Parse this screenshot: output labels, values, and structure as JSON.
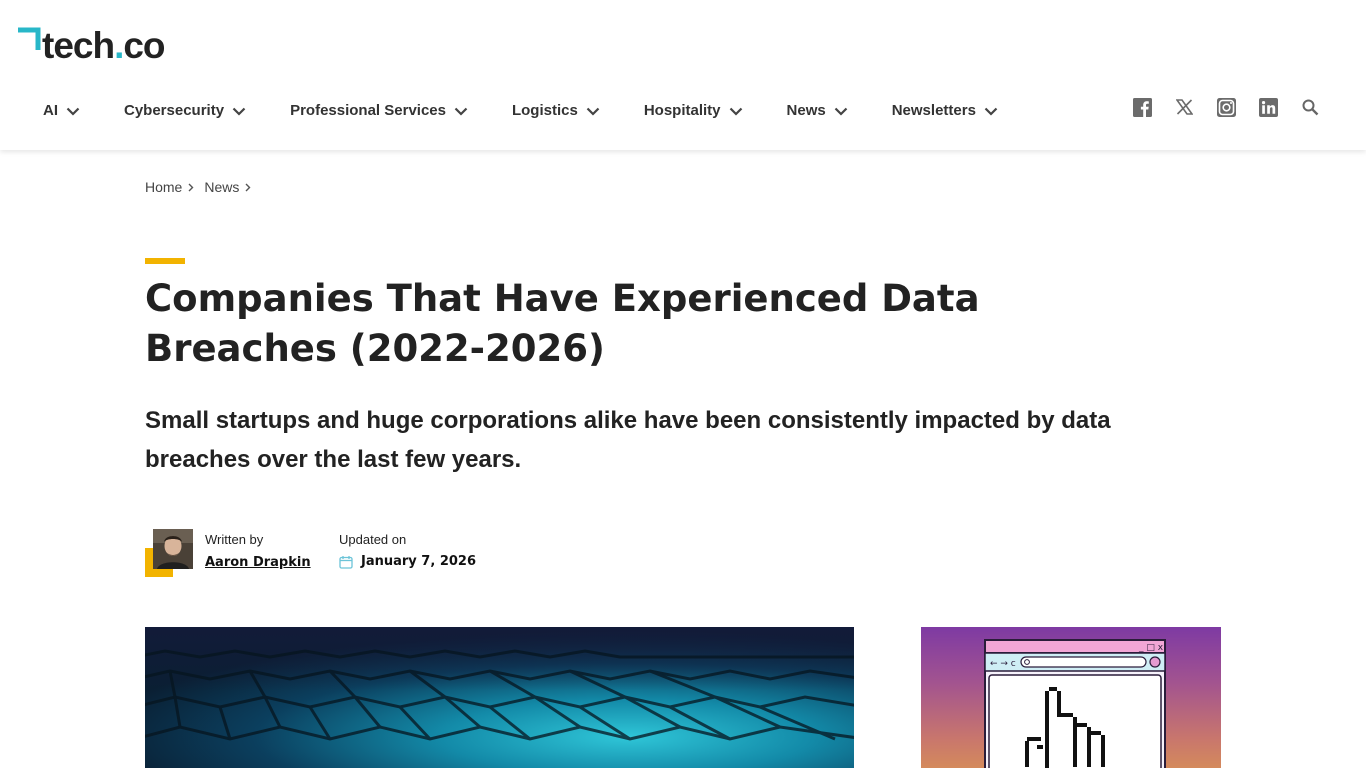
{
  "brand": {
    "logo_text": "tech",
    "logo_dot": ".",
    "logo_tld": "co"
  },
  "nav": {
    "items": [
      {
        "label": "AI"
      },
      {
        "label": "Cybersecurity"
      },
      {
        "label": "Professional Services"
      },
      {
        "label": "Logistics"
      },
      {
        "label": "Hospitality"
      },
      {
        "label": "News"
      },
      {
        "label": "Newsletters"
      }
    ]
  },
  "social": [
    "facebook-icon",
    "x-icon",
    "instagram-icon",
    "linkedin-icon",
    "search-icon"
  ],
  "breadcrumb": {
    "home": "Home",
    "section": "News"
  },
  "article": {
    "title": "Companies That Have Experienced Data Breaches (2022-2026)",
    "subtitle": "Small startups and huge corporations alike have been consistently impacted by data breaches over the last few years.",
    "written_by_label": "Written by",
    "author": "Aaron Drapkin",
    "updated_label": "Updated on",
    "updated_date": "January 7, 2026"
  },
  "colors": {
    "accent": "#f2b300",
    "brand_teal": "#28b7c8",
    "text": "#222222"
  }
}
